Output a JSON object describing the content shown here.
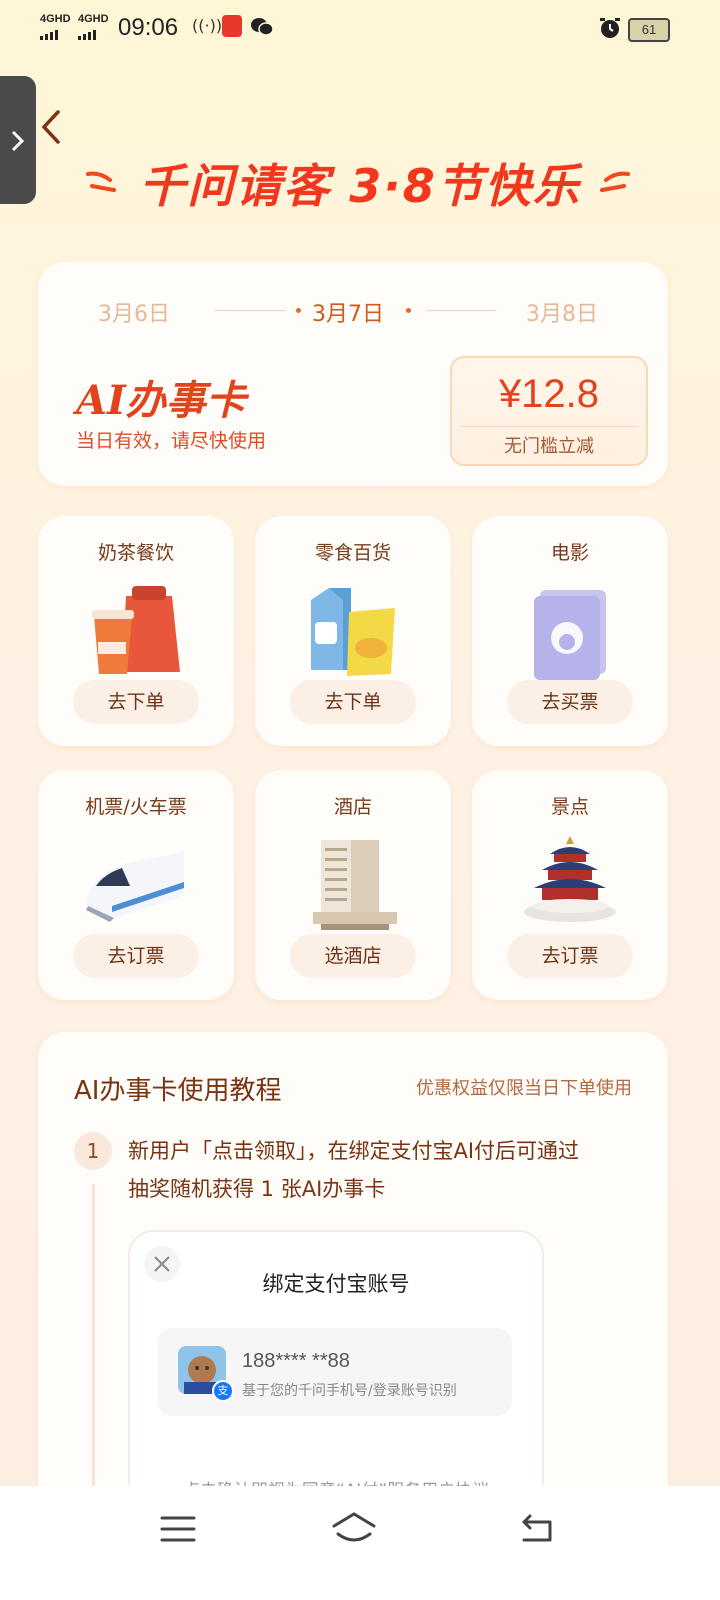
{
  "status_bar": {
    "net1": "4GHD",
    "net2": "4GHD",
    "time": "09:06",
    "battery": "61"
  },
  "banner": {
    "title": "千问请客 3·8节快乐"
  },
  "promo_card": {
    "dates": [
      "3月6日",
      "3月7日",
      "3月8日"
    ],
    "selected_date_index": 1,
    "card_name": "AI办事卡",
    "card_desc": "当日有效，请尽快使用",
    "price": "¥12.8",
    "price_desc": "无门槛立减"
  },
  "categories": [
    {
      "label": "奶茶餐饮",
      "button": "去下单",
      "icon": "milk-tea-bag-icon"
    },
    {
      "label": "零食百货",
      "button": "去下单",
      "icon": "milk-carton-chips-icon"
    },
    {
      "label": "电影",
      "button": "去买票",
      "icon": "movie-ticket-icon"
    },
    {
      "label": "机票/火车票",
      "button": "去订票",
      "icon": "train-icon"
    },
    {
      "label": "酒店",
      "button": "选酒店",
      "icon": "hotel-building-icon"
    },
    {
      "label": "景点",
      "button": "去订票",
      "icon": "temple-of-heaven-icon"
    }
  ],
  "tutorial": {
    "title": "AI办事卡使用教程",
    "note": "优惠权益仅限当日下单使用",
    "steps": [
      {
        "num": "1",
        "text_line1": "新用户「点击领取」，在绑定支付宝AI付后可通过",
        "text_line2": "抽奖随机获得 1 张AI办事卡"
      }
    ],
    "bind_dialog": {
      "title": "绑定支付宝账号",
      "phone": "188**** **88",
      "phone_desc": "基于您的千问手机号/登录账号识别",
      "footer": "点击确认即视为同意“AI付”服务用户协议"
    }
  },
  "colors": {
    "accent": "#e2431d",
    "title_red": "#f2371f",
    "brown": "#7a3412"
  }
}
